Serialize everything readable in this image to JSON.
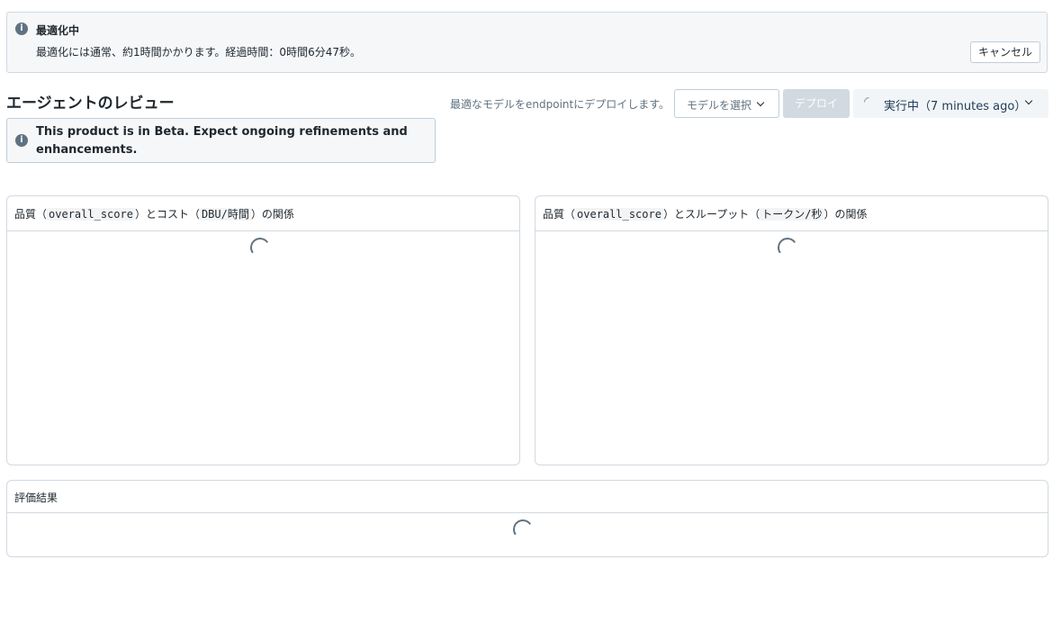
{
  "banner": {
    "title": "最適化中",
    "message": "最適化には通常、約1時間かかります。経過時間：0時間6分47秒。",
    "cancel_label": "キャンセル"
  },
  "review": {
    "title": "エージェントのレビュー",
    "beta_notice": "This product is in Beta. Expect ongoing refinements and enhancements."
  },
  "toolbar": {
    "deploy_hint": "最適なモデルをendpointにデプロイします。",
    "model_select_label": "モデルを選択",
    "deploy_label": "デプロイ",
    "status_label": "実行中（7 minutes ago）"
  },
  "cards": {
    "cost": {
      "title_prefix": "品質（",
      "metric": "overall_score",
      "title_mid": "）とコスト（",
      "unit": "DBU/時間",
      "title_suffix": "）の関係"
    },
    "throughput": {
      "title_prefix": "品質（",
      "metric": "overall_score",
      "title_mid": "）とスループット（",
      "unit": "トークン/秒",
      "title_suffix": "）の関係"
    },
    "results": {
      "title": "評価結果"
    }
  },
  "icons": {
    "info": "info-icon",
    "chevron": "chevron-down-icon",
    "spinner": "loading-spinner-icon"
  }
}
